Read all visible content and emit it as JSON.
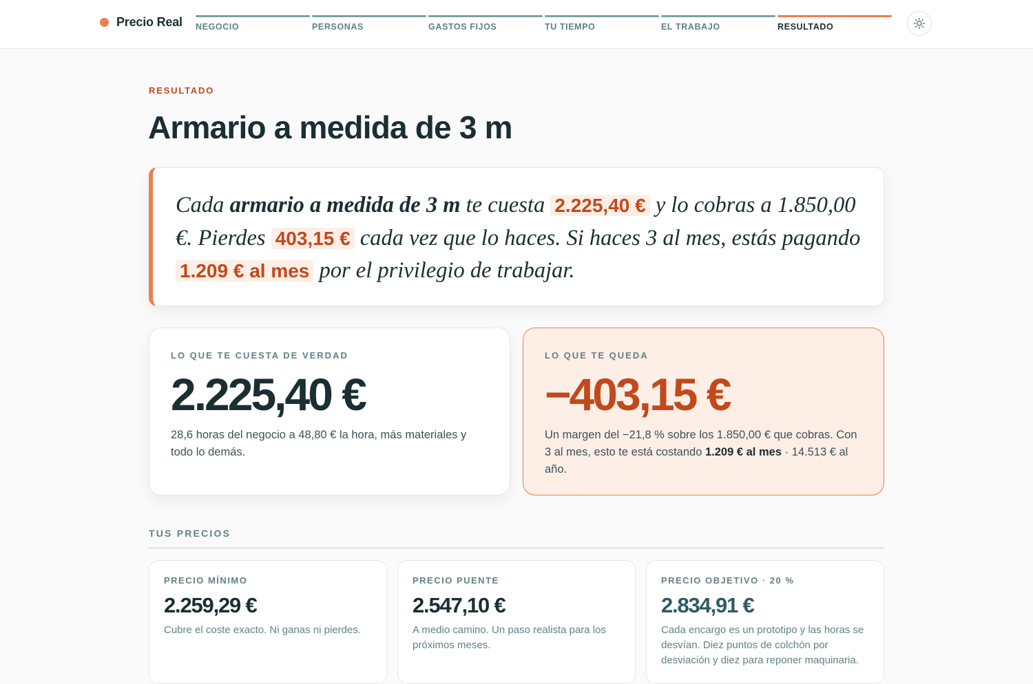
{
  "header": {
    "brand": "Precio Real",
    "steps": [
      {
        "label": "NEGOCIO"
      },
      {
        "label": "PERSONAS"
      },
      {
        "label": "GASTOS FIJOS"
      },
      {
        "label": "TU TIEMPO"
      },
      {
        "label": "EL TRABAJO"
      },
      {
        "label": "RESULTADO"
      }
    ],
    "active_step": "RESULTADO",
    "theme_icon": "sun-icon"
  },
  "main": {
    "eyebrow": "RESULTADO",
    "title": "Armario a medida de 3 m",
    "statement": {
      "t1": "Cada ",
      "product": "armario a medida de 3 m",
      "t2": " te cuesta ",
      "cost": "2.225,40 €",
      "t3": " y lo cobras a 1.850,00 €. Pierdes ",
      "loss": "403,15 €",
      "t4": " cada vez que lo haces. Si haces 3 al mes, estás pagando ",
      "monthly": "1.209 € al mes",
      "t5": " por el privilegio de trabajar."
    },
    "cost_card": {
      "label": "LO QUE TE CUESTA DE VERDAD",
      "value": "2.225,40 €",
      "desc": "28,6 horas del negocio a 48,80 € la hora, más materiales y todo lo demás."
    },
    "remaining_card": {
      "label": "LO QUE TE QUEDA",
      "value": "−403,15 €",
      "desc_1": "Un margen del −21,8 % sobre los 1.850,00 € que cobras. Con 3 al mes, esto te está costando ",
      "desc_bold": "1.209 € al mes",
      "desc_2": " · 14.513 € al año."
    },
    "prices_section": {
      "title": "TUS PRECIOS",
      "cards": [
        {
          "label": "PRECIO MÍNIMO",
          "value": "2.259,29 €",
          "desc": "Cubre el coste exacto. Ni ganas ni pierdes."
        },
        {
          "label": "PRECIO PUENTE",
          "value": "2.547,10 €",
          "desc": "A medio camino. Un paso realista para los próximos meses."
        },
        {
          "label": "PRECIO OBJETIVO · 20 %",
          "value": "2.834,91 €",
          "desc": "Cada encargo es un prototipo y las horas se desvían. Diez puntos de colchón por desviación y diez para reponer maquinaria."
        }
      ]
    }
  },
  "colors": {
    "accent": "#ef7d4f",
    "accent_dark": "#c2491c",
    "ink": "#1a2e33",
    "muted": "#5f8286",
    "accent_soft": "#fdeee6"
  }
}
